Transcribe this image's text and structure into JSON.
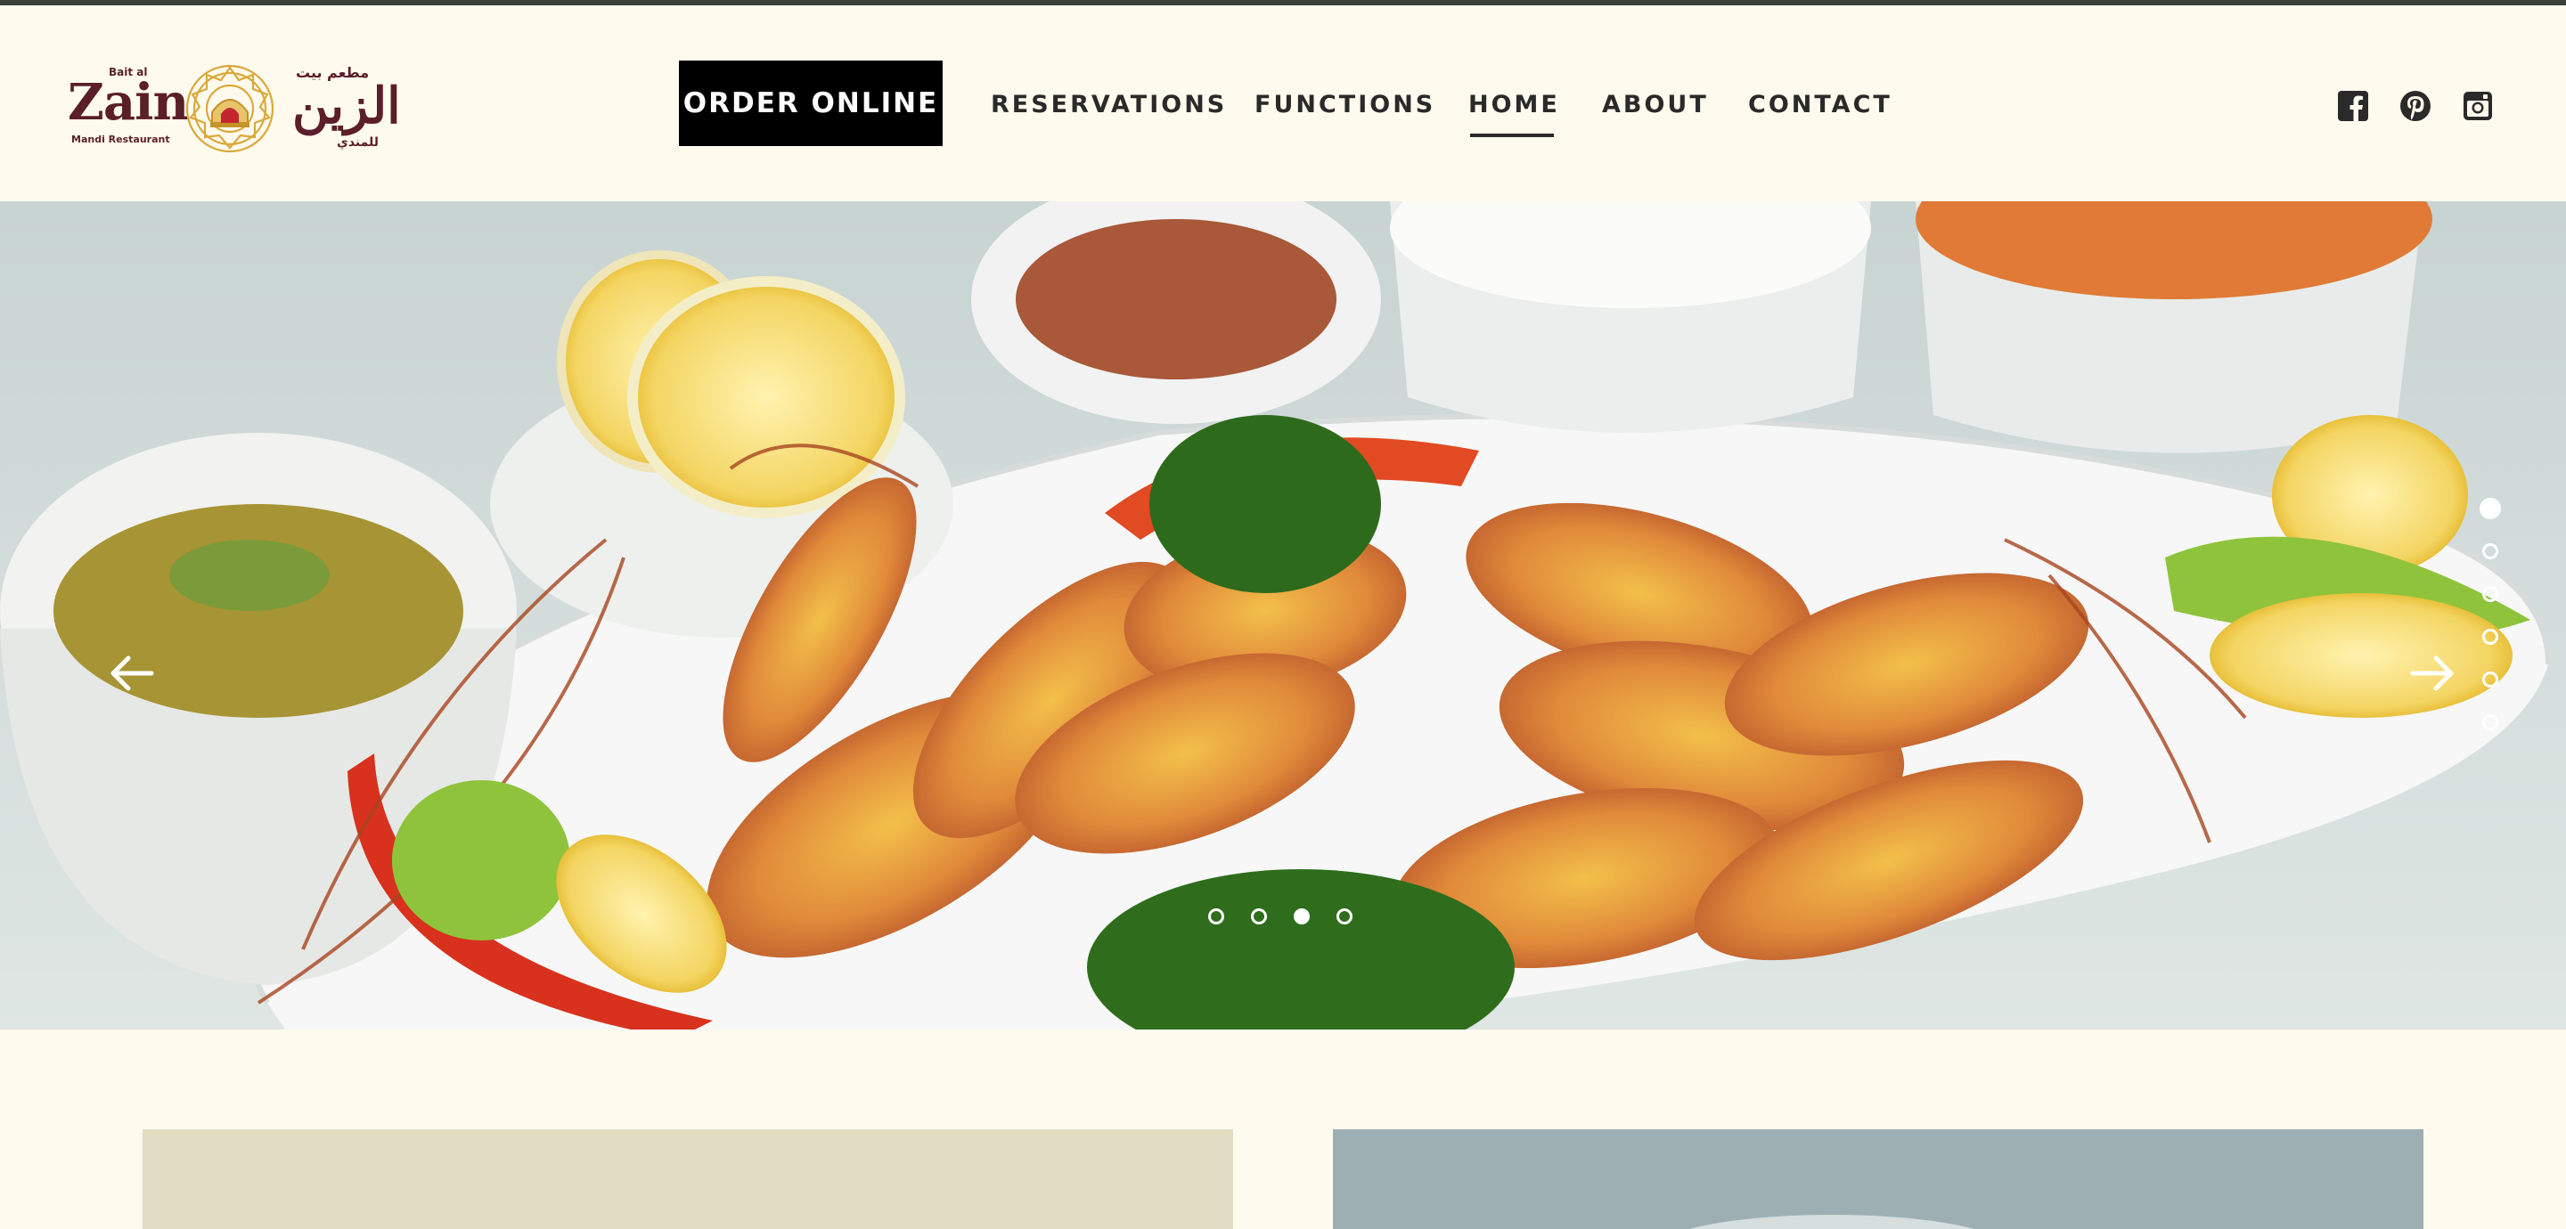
{
  "brand": {
    "name_en_small": "Bait al",
    "name_en": "Zain",
    "tagline_en": "Mandi Restaurant",
    "name_ar_small": "مطعم بيت",
    "name_ar": "الزين",
    "tagline_ar": "للمندي",
    "color": "#5a1f28",
    "emblem_color": "#d9a93a"
  },
  "header": {
    "order_label": "ORDER ONLINE",
    "nav": [
      {
        "label": "RESERVATIONS"
      },
      {
        "label": "FUNCTIONS"
      },
      {
        "label": "HOME",
        "active": true
      },
      {
        "label": "ABOUT"
      },
      {
        "label": "CONTACT"
      }
    ],
    "social": [
      "facebook-icon",
      "pinterest-icon",
      "instagram-icon"
    ]
  },
  "hero": {
    "image_description": "Grilled prawns platter with lemon, soup, rice and sauce bowls",
    "prev_icon": "arrow-left-icon",
    "next_icon": "arrow-right-icon",
    "horizontal_dots": {
      "count": 4,
      "active_index": 2
    },
    "vertical_dots": {
      "count": 6,
      "active_index": 0
    }
  },
  "colors": {
    "page_bg": "#fffaee",
    "text": "#2a2a2a",
    "button_bg": "#000000",
    "card_left": "#e2dcc2"
  }
}
